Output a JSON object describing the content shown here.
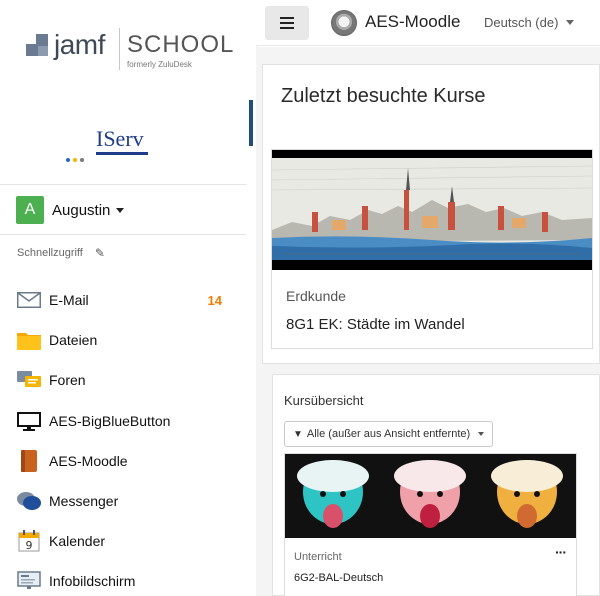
{
  "sidebar": {
    "brand": {
      "jamf": "jamf",
      "school": "SCHOOL",
      "formerly": "formerly ZuluDesk"
    },
    "iserv": "IServ",
    "user": {
      "initial": "A",
      "name": "Augustin"
    },
    "quick_access_label": "Schnellzugriff",
    "items": [
      {
        "label": "E-Mail",
        "icon": "mail-icon",
        "badge": "14"
      },
      {
        "label": "Dateien",
        "icon": "folder-icon"
      },
      {
        "label": "Foren",
        "icon": "forum-icon"
      },
      {
        "label": "AES-BigBlueButton",
        "icon": "monitor-icon"
      },
      {
        "label": "AES-Moodle",
        "icon": "book-icon"
      },
      {
        "label": "Messenger",
        "icon": "chat-icon"
      },
      {
        "label": "Kalender",
        "icon": "calendar-icon",
        "day": "9"
      },
      {
        "label": "Infobildschirm",
        "icon": "display-icon"
      }
    ]
  },
  "header": {
    "site_name": "AES-Moodle",
    "language": "Deutsch (de)"
  },
  "recent": {
    "title": "Zuletzt besuchte Kurse",
    "course": {
      "category": "Erdkunde",
      "name": "8G1 EK: Städte im Wandel"
    }
  },
  "overview": {
    "title": "Kursübersicht",
    "filter": "Alle (außer aus Ansicht entfernte)",
    "course": {
      "category": "Unterricht",
      "name": "6G2-BAL-Deutsch",
      "menu": "···"
    }
  },
  "colors": {
    "accent_blue": "#1f4e79",
    "badge_orange": "#ef7d00",
    "avatar_green": "#4caf50"
  }
}
